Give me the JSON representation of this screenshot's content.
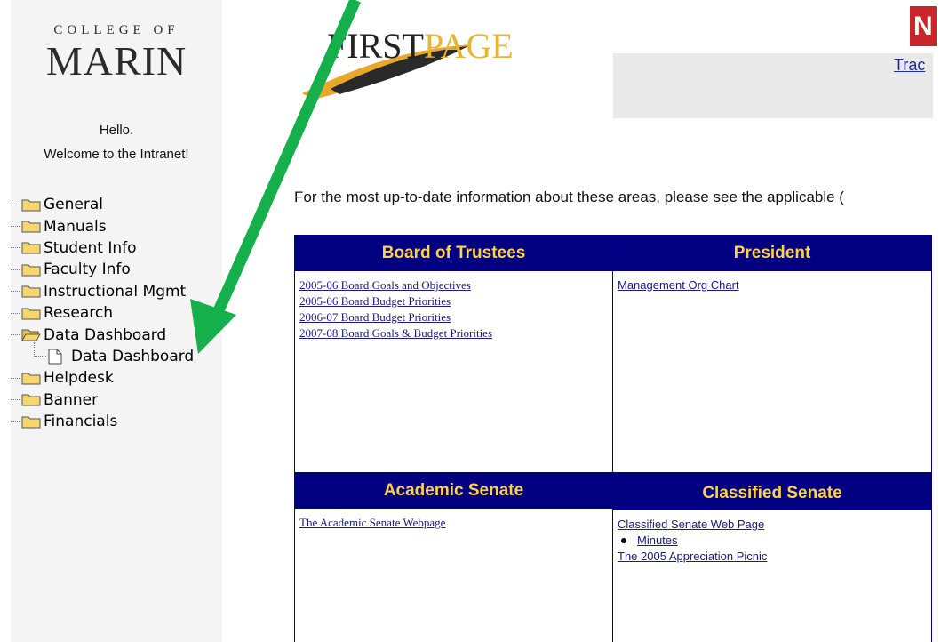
{
  "sidebar": {
    "logo_top": "COLLEGE OF",
    "logo_main": "MARIN",
    "greeting_line1": "Hello.",
    "greeting_line2": "Welcome to the Intranet!",
    "tree": [
      {
        "label": "General"
      },
      {
        "label": "Manuals"
      },
      {
        "label": "Student Info"
      },
      {
        "label": "Faculty Info"
      },
      {
        "label": "Instructional Mgmt"
      },
      {
        "label": "Research"
      },
      {
        "label": "Data Dashboard",
        "expanded": true
      },
      {
        "label": "Data Dashboard",
        "child": true
      },
      {
        "label": "Helpdesk"
      },
      {
        "label": "Banner"
      },
      {
        "label": "Financials"
      }
    ]
  },
  "header": {
    "logo_first": "FIRST",
    "logo_page": "PAGE",
    "track_link": "Trac",
    "badge_letter": "N"
  },
  "intro": "For the most up-to-date information about these areas, please see the applicable (",
  "panels": {
    "board": {
      "title": "Board of Trustees",
      "links": [
        "2005-06 Board Goals and Objectives",
        "2005-06 Board Budget Priorities",
        "2006-07 Board Budget Priorities",
        "2007-08 Board Goals & Budget Priorities"
      ]
    },
    "president": {
      "title": "President",
      "links": [
        "Management Org Chart"
      ]
    },
    "academic": {
      "title": "Academic Senate",
      "links": [
        "The Academic Senate Webpage"
      ]
    },
    "classified": {
      "title": "Classified Senate",
      "link1": "Classified Senate Web Page",
      "bullet_link": "Minutes",
      "link2": "The 2005 Appreciation Picnic"
    }
  },
  "colors": {
    "panel_header_bg": "#000080",
    "panel_header_text": "#ffd24a",
    "annotation_arrow": "#15b04b"
  }
}
